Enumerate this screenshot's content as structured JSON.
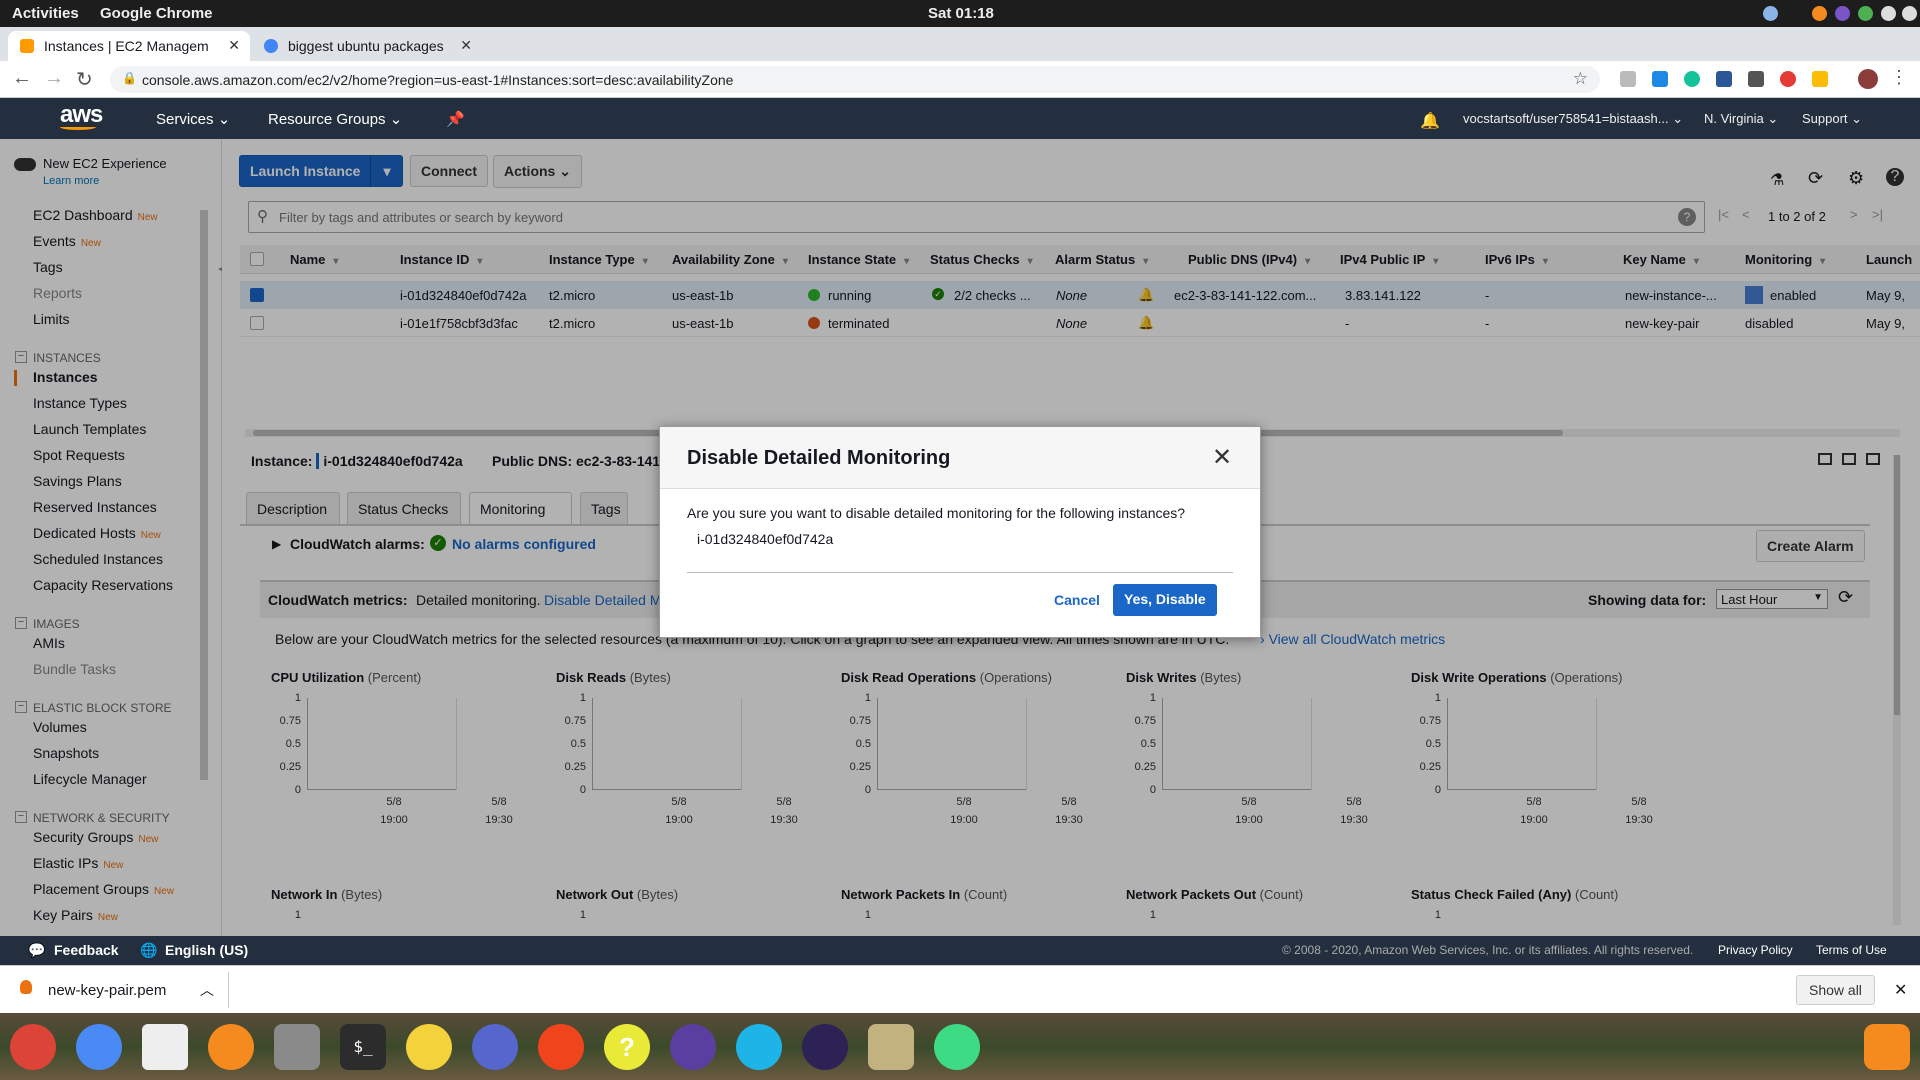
{
  "gnome": {
    "activities": "Activities",
    "app": "Google Chrome",
    "clock": "Sat 01:18"
  },
  "browser": {
    "tabs": [
      {
        "title": "Instances | EC2 Managem",
        "active": true
      },
      {
        "title": "biggest ubuntu packages",
        "active": false
      }
    ],
    "url": "console.aws.amazon.com/ec2/v2/home?region=us-east-1#Instances:sort=desc:availabilityZone"
  },
  "aws_header": {
    "logo": "aws",
    "services": "Services",
    "resource_groups": "Resource Groups",
    "account": "vocstartsoft/user758541=bistaash...",
    "region": "N. Virginia",
    "support": "Support"
  },
  "sidebar": {
    "new_experience": "New EC2 Experience",
    "learn_more": "Learn more",
    "new_badge": "New",
    "top_items": [
      {
        "label": "EC2 Dashboard",
        "new": true,
        "dim": false
      },
      {
        "label": "Events",
        "new": true,
        "dim": false
      },
      {
        "label": "Tags",
        "new": false,
        "dim": false
      },
      {
        "label": "Reports",
        "new": false,
        "dim": true
      },
      {
        "label": "Limits",
        "new": false,
        "dim": false
      }
    ],
    "sections": [
      {
        "title": "INSTANCES",
        "items": [
          {
            "label": "Instances",
            "active": true
          },
          {
            "label": "Instance Types"
          },
          {
            "label": "Launch Templates"
          },
          {
            "label": "Spot Requests"
          },
          {
            "label": "Savings Plans"
          },
          {
            "label": "Reserved Instances"
          },
          {
            "label": "Dedicated Hosts",
            "new": true
          },
          {
            "label": "Scheduled Instances"
          },
          {
            "label": "Capacity Reservations"
          }
        ]
      },
      {
        "title": "IMAGES",
        "items": [
          {
            "label": "AMIs"
          },
          {
            "label": "Bundle Tasks",
            "dim": true
          }
        ]
      },
      {
        "title": "ELASTIC BLOCK STORE",
        "items": [
          {
            "label": "Volumes"
          },
          {
            "label": "Snapshots"
          },
          {
            "label": "Lifecycle Manager"
          }
        ]
      },
      {
        "title": "NETWORK & SECURITY",
        "items": [
          {
            "label": "Security Groups",
            "new": true
          },
          {
            "label": "Elastic IPs",
            "new": true
          },
          {
            "label": "Placement Groups",
            "new": true
          },
          {
            "label": "Key Pairs",
            "new": true
          }
        ]
      }
    ]
  },
  "toolbar": {
    "launch": "Launch Instance",
    "connect": "Connect",
    "actions": "Actions",
    "filter_placeholder": "Filter by tags and attributes or search by keyword",
    "pagination": "1 to 2 of 2"
  },
  "table": {
    "columns": [
      "Name",
      "Instance ID",
      "Instance Type",
      "Availability Zone",
      "Instance State",
      "Status Checks",
      "Alarm Status",
      "Public DNS (IPv4)",
      "IPv4 Public IP",
      "IPv6 IPs",
      "Key Name",
      "Monitoring",
      "Launch"
    ],
    "rows": [
      {
        "name": "",
        "id": "i-01d324840ef0d742a",
        "type": "t2.micro",
        "az": "us-east-1b",
        "state": "running",
        "state_color": "#2eb82e",
        "checks": "2/2 checks ...",
        "alarm": "None",
        "dns": "ec2-3-83-141-122.com...",
        "ipv4": "3.83.141.122",
        "ipv6": "-",
        "key": "new-instance-...",
        "monitoring": "enabled",
        "launch": "May 9,"
      },
      {
        "name": "",
        "id": "i-01e1f758cbf3d3fac",
        "type": "t2.micro",
        "az": "us-east-1b",
        "state": "terminated",
        "state_color": "#d9531e",
        "checks": "",
        "alarm": "None",
        "dns": "",
        "ipv4": "-",
        "ipv6": "-",
        "key": "new-key-pair",
        "monitoring": "disabled",
        "launch": "May 9,"
      }
    ]
  },
  "detail": {
    "instance_label": "Instance:",
    "instance_id": "i-01d324840ef0d742a",
    "dns_label": "Public DNS: ec2-3-83-141",
    "tabs": [
      "Description",
      "Status Checks",
      "Monitoring",
      "Tags"
    ],
    "cw_alarms_label": "CloudWatch alarms:",
    "cw_alarms_value": "No alarms configured",
    "create_alarm": "Create Alarm",
    "cw_metrics_label": "CloudWatch metrics:",
    "cw_metrics_text": "Detailed monitoring.",
    "disable_link": "Disable Detailed M",
    "showing_label": "Showing data for:",
    "showing_value": "Last Hour",
    "below_text": "Below are your CloudWatch metrics for the selected resources (a maximum of 10). Click on a graph to see an expanded view. All times shown are in UTC.",
    "view_all": "View all CloudWatch metrics",
    "graphs": [
      {
        "title": "CPU Utilization",
        "unit": "(Percent)"
      },
      {
        "title": "Disk Reads",
        "unit": "(Bytes)"
      },
      {
        "title": "Disk Read Operations",
        "unit": "(Operations)"
      },
      {
        "title": "Disk Writes",
        "unit": "(Bytes)"
      },
      {
        "title": "Disk Write Operations",
        "unit": "(Operations)"
      }
    ],
    "graphs2": [
      {
        "title": "Network In",
        "unit": "(Bytes)"
      },
      {
        "title": "Network Out",
        "unit": "(Bytes)"
      },
      {
        "title": "Network Packets In",
        "unit": "(Count)"
      },
      {
        "title": "Network Packets Out",
        "unit": "(Count)"
      },
      {
        "title": "Status Check Failed (Any)",
        "unit": "(Count)"
      }
    ],
    "yticks": [
      "1",
      "0.75",
      "0.5",
      "0.25",
      "0"
    ],
    "xticks": [
      {
        "d": "5/8",
        "t": "19:00"
      },
      {
        "d": "5/8",
        "t": "19:30"
      }
    ]
  },
  "footer": {
    "feedback": "Feedback",
    "language": "English (US)",
    "copyright": "© 2008 - 2020, Amazon Web Services, Inc. or its affiliates. All rights reserved.",
    "privacy": "Privacy Policy",
    "terms": "Terms of Use"
  },
  "download": {
    "file": "new-key-pair.pem",
    "show_all": "Show all"
  },
  "modal": {
    "title": "Disable Detailed Monitoring",
    "message": "Are you sure you want to disable detailed monitoring for the following instances?",
    "instance": "i-01d324840ef0d742a",
    "cancel": "Cancel",
    "confirm": "Yes, Disable"
  },
  "colors": {
    "aws_dark": "#232f3e",
    "aws_orange": "#ff9900",
    "primary": "#1a67c8"
  }
}
